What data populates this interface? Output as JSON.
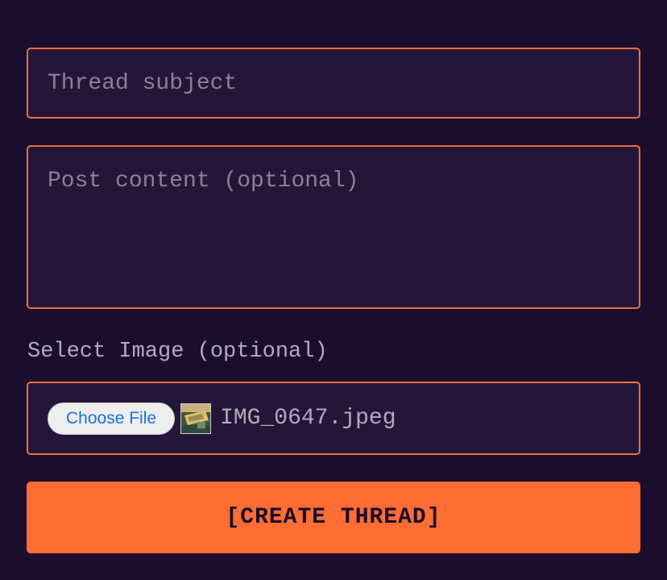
{
  "form": {
    "subject_placeholder": "Thread subject",
    "content_placeholder": "Post content (optional)",
    "image_label": "Select Image (optional)",
    "choose_file_label": "Choose File",
    "file_thumbnail": "image-thumbnail",
    "file_name": "IMG_0647.jpeg",
    "submit_label": "[CREATE THREAD]"
  },
  "colors": {
    "background": "#1b0d2c",
    "field_background": "#241639",
    "accent": "#ee6e3e",
    "button": "#ff6c34",
    "placeholder_text": "#8a8098",
    "link_blue": "#1a73d9"
  }
}
